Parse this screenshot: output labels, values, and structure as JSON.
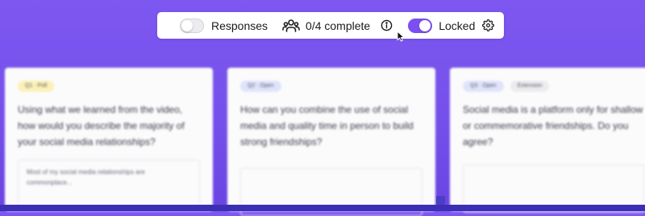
{
  "toolbar": {
    "responses_label": "Responses",
    "responses_on": false,
    "complete_text": "0/4 complete",
    "locked_label": "Locked",
    "locked_on": true
  },
  "cards": [
    {
      "tags": [
        "Q1 · Poll"
      ],
      "question": "Using what we learned from the video, how would you describe the majority of your social media relationships?",
      "answer": "Most of my social media relationships are commonplace..."
    },
    {
      "tags": [
        "Q2 · Open"
      ],
      "question": "How can you combine the use of social media and quality time in person to build strong friendships?",
      "answer": ""
    },
    {
      "tags": [
        "Q3 · Open",
        "Extension"
      ],
      "question": "Social media is a platform only for shallow or commemorative friendships. Do you agree?",
      "answer": ""
    }
  ],
  "colors": {
    "background": "#7550ea",
    "accent": "#7c4ff0",
    "toolbar_bg": "#ffffff",
    "card_bg": "#fbfbfc"
  }
}
